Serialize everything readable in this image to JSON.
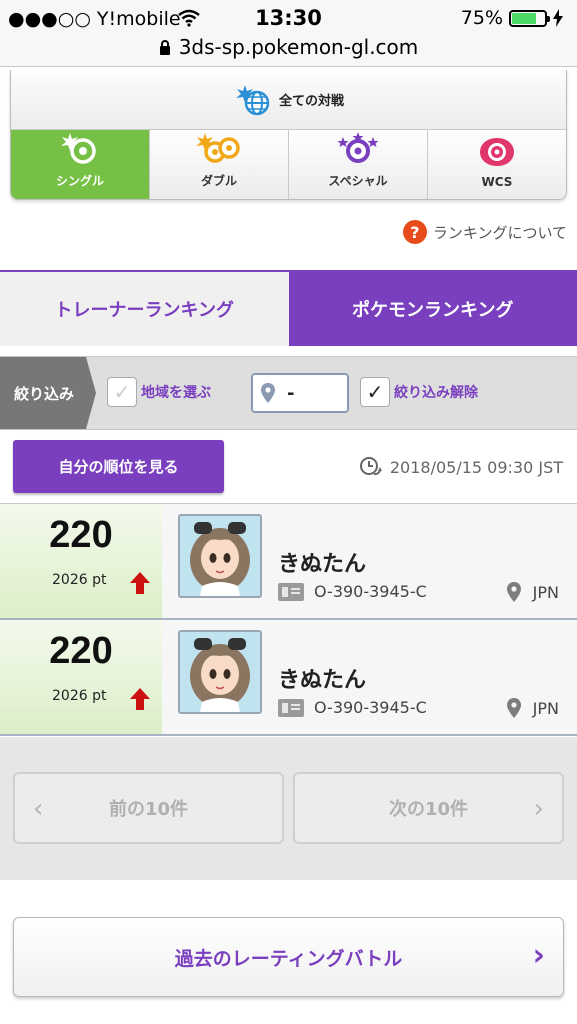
{
  "status_bar": {
    "carrier": "●●●○○ Y!mobile",
    "time": "13:30",
    "battery": "75%",
    "battery_level": 0.75
  },
  "browser": {
    "url": "3ds-sp.pokemon-gl.com"
  },
  "battle_types": {
    "all_label": "全ての対戦",
    "tabs": [
      {
        "label": "シングル",
        "icon": "single-battle-icon",
        "active": true
      },
      {
        "label": "ダブル",
        "icon": "double-battle-icon",
        "active": false
      },
      {
        "label": "スペシャル",
        "icon": "special-battle-icon",
        "active": false
      },
      {
        "label": "WCS",
        "icon": "wcs-battle-icon",
        "active": false
      }
    ]
  },
  "about_ranking": "ランキングについて",
  "ranking_tabs": {
    "trainer": "トレーナーランキング",
    "pokemon": "ポケモンランキング",
    "active": "pokemon"
  },
  "filter": {
    "label": "絞り込み",
    "region_checkbox_label": "地域を選ぶ",
    "region_value": "-",
    "clear_label": "絞り込み解除"
  },
  "own_rank_button": "自分の順位を見る",
  "updated_at": "2018/05/15 09:30 JST",
  "rankings": [
    {
      "rank": "220",
      "points": "2026 pt",
      "trend": "up",
      "name": "きぬたん",
      "id": "O-390-3945-C",
      "country": "JPN"
    },
    {
      "rank": "220",
      "points": "2026 pt",
      "trend": "up",
      "name": "きぬたん",
      "id": "O-390-3945-C",
      "country": "JPN"
    }
  ],
  "pagination": {
    "prev": "前の10件",
    "next": "次の10件"
  },
  "past_rating_battle": "過去のレーティングバトル",
  "colors": {
    "purple": "#7a3fbf",
    "green_active": "#77c046",
    "rank_up_arrow": "#cc1111"
  }
}
